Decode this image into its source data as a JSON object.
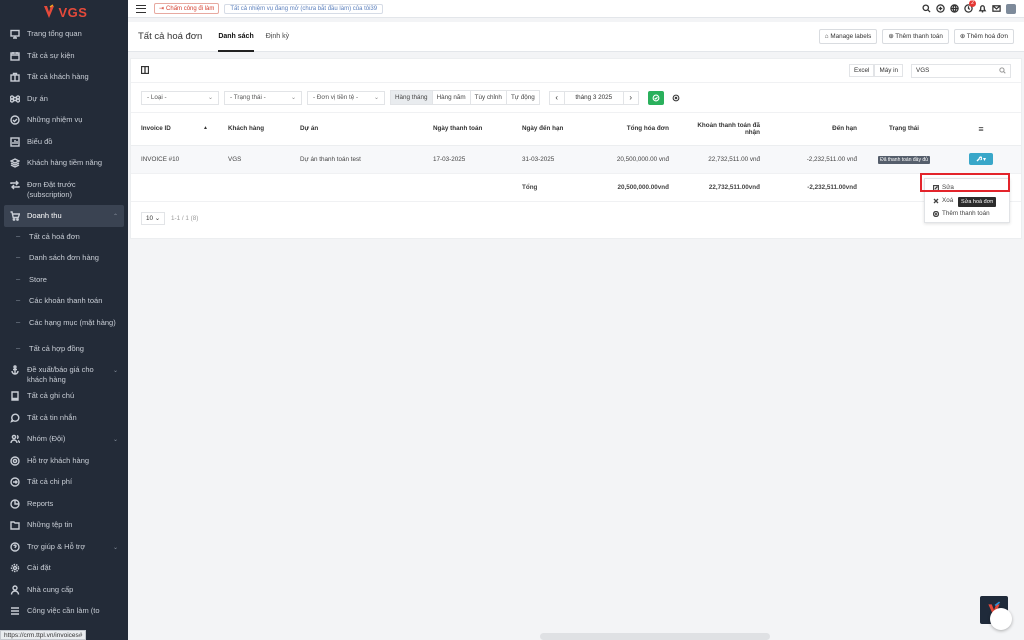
{
  "brand": {
    "logo_text": "VGS"
  },
  "sidebar": {
    "items": [
      {
        "label": "Trang tổng quan",
        "icon": "monitor-icon"
      },
      {
        "label": "Tất cả sự kiện",
        "icon": "calendar-icon"
      },
      {
        "label": "Tất cả khách hàng",
        "icon": "briefcase-icon"
      },
      {
        "label": "Dự án",
        "icon": "command-icon"
      },
      {
        "label": "Những nhiệm vụ",
        "icon": "check-circle-icon"
      },
      {
        "label": "Biểu đồ",
        "icon": "chart-icon"
      },
      {
        "label": "Khách hàng tiềm năng",
        "icon": "layers-icon"
      },
      {
        "label": "Đơn Đặt trước (subscription)",
        "icon": "repeat-icon"
      },
      {
        "label": "Doanh thu",
        "icon": "cart-icon"
      },
      {
        "label": "Tất cả hoá đơn",
        "icon": ""
      },
      {
        "label": "Danh sách đơn hàng",
        "icon": ""
      },
      {
        "label": "Store",
        "icon": ""
      },
      {
        "label": "Các khoản thanh toán",
        "icon": ""
      },
      {
        "label": "Các hạng mục (mặt hàng)",
        "icon": ""
      },
      {
        "label": "Tất cả hợp đồng",
        "icon": ""
      },
      {
        "label": "Đề xuất/báo giá cho khách hàng",
        "icon": "anchor-icon"
      },
      {
        "label": "Tất cả ghi chú",
        "icon": "book-icon"
      },
      {
        "label": "Tất cả tin nhắn",
        "icon": "message-icon"
      },
      {
        "label": "Nhóm (Đội)",
        "icon": "users-icon"
      },
      {
        "label": "Hỗ trợ khách hàng",
        "icon": "life-buoy-icon"
      },
      {
        "label": "Tất cả chi phí",
        "icon": "arrow-circle-icon"
      },
      {
        "label": "Reports",
        "icon": "pie-icon"
      },
      {
        "label": "Những tệp tin",
        "icon": "folder-icon"
      },
      {
        "label": "Trợ giúp & Hỗ trợ",
        "icon": "help-icon"
      },
      {
        "label": "Cài đặt",
        "icon": "gear-icon"
      },
      {
        "label": "Nhà cung cấp",
        "icon": "user-icon"
      },
      {
        "label": "Công việc cần làm (to",
        "icon": "list-icon"
      }
    ]
  },
  "status_url": "https://crm.ttpl.vn/invoices#",
  "topbar": {
    "clock_in": "Chấm công đi làm",
    "task_notice": "Tất cả nhiệm vụ đang mở (chưa bắt đầu làm) của tôi39",
    "notif_count": "2"
  },
  "page": {
    "title": "Tất cả hoá đơn",
    "tabs": [
      "Danh sách",
      "Định kỳ"
    ],
    "buttons": [
      "Manage labels",
      "Thêm thanh toán",
      "Thêm hoá đơn"
    ]
  },
  "toolbar": {
    "excel": "Excel",
    "print": "Máy in",
    "search_value": "VGS",
    "filters": [
      "- Loại -",
      "- Trạng thái -",
      "- Đơn vị tiền tệ -"
    ],
    "periods": [
      "Hàng tháng",
      "Hàng năm",
      "Tùy chỉnh",
      "Tự động"
    ],
    "month": "tháng 3 2025"
  },
  "table": {
    "columns": [
      "Invoice ID",
      "Khách hàng",
      "Dự án",
      "Ngày thanh toán",
      "Ngày đến hạn",
      "Tổng hóa đơn",
      "Khoản thanh toán đã nhận",
      "Đến hạn",
      "Trạng thái"
    ],
    "rows": [
      {
        "id": "INVOICE #10",
        "client": "VGS",
        "project": "Dự án thanh toán test",
        "bill_date": "17-03-2025",
        "due_date": "31-03-2025",
        "total": "20,500,000.00 vnđ",
        "paid": "22,732,511.00 vnđ",
        "due": "-2,232,511.00 vnđ",
        "status": "Đã thanh toán đầy đủ"
      }
    ],
    "footer": {
      "label": "Tổng",
      "total": "20,500,000.00vnđ",
      "paid": "22,732,511.00vnđ",
      "due": "-2,232,511.00vnđ"
    }
  },
  "pager": {
    "size": "10",
    "info": "1-1 / 1 (8)"
  },
  "dropdown": {
    "items": [
      "Sửa",
      "Xoá",
      "Thêm thanh toán"
    ],
    "tooltip": "Sửa hoá đơn"
  }
}
